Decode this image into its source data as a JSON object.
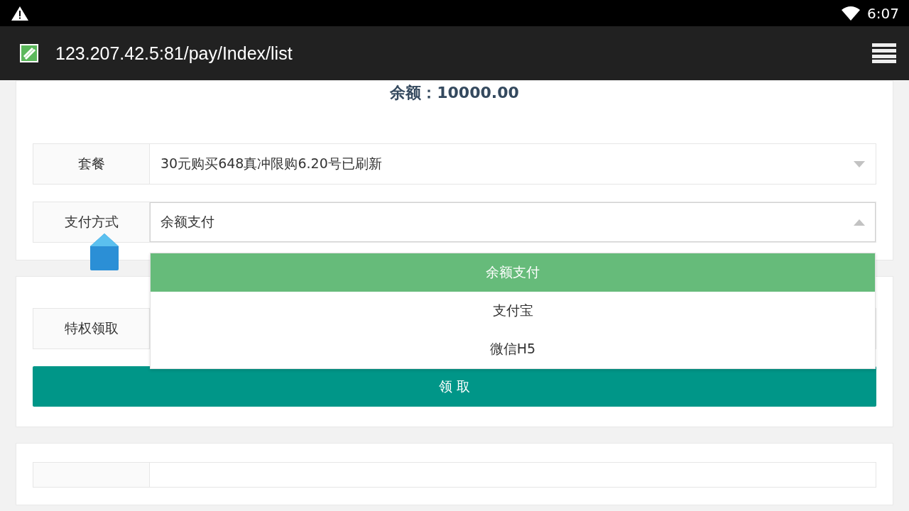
{
  "status_bar": {
    "time": "6:07"
  },
  "browser": {
    "url": "123.207.42.5:81/pay/Index/list"
  },
  "balance": "余额：10000.00",
  "form": [
    {
      "label": "套餐",
      "value": "30元购买648真冲限购6.20号已刷新",
      "expanded": false
    },
    {
      "label": "支付方式",
      "value": "余额支付",
      "expanded": true,
      "options": [
        {
          "label": "余额支付",
          "selected": true
        },
        {
          "label": "支付宝",
          "selected": false
        },
        {
          "label": "微信H5",
          "selected": false
        }
      ]
    }
  ],
  "privilege": {
    "label": "特权领取"
  },
  "submit": "领 取"
}
